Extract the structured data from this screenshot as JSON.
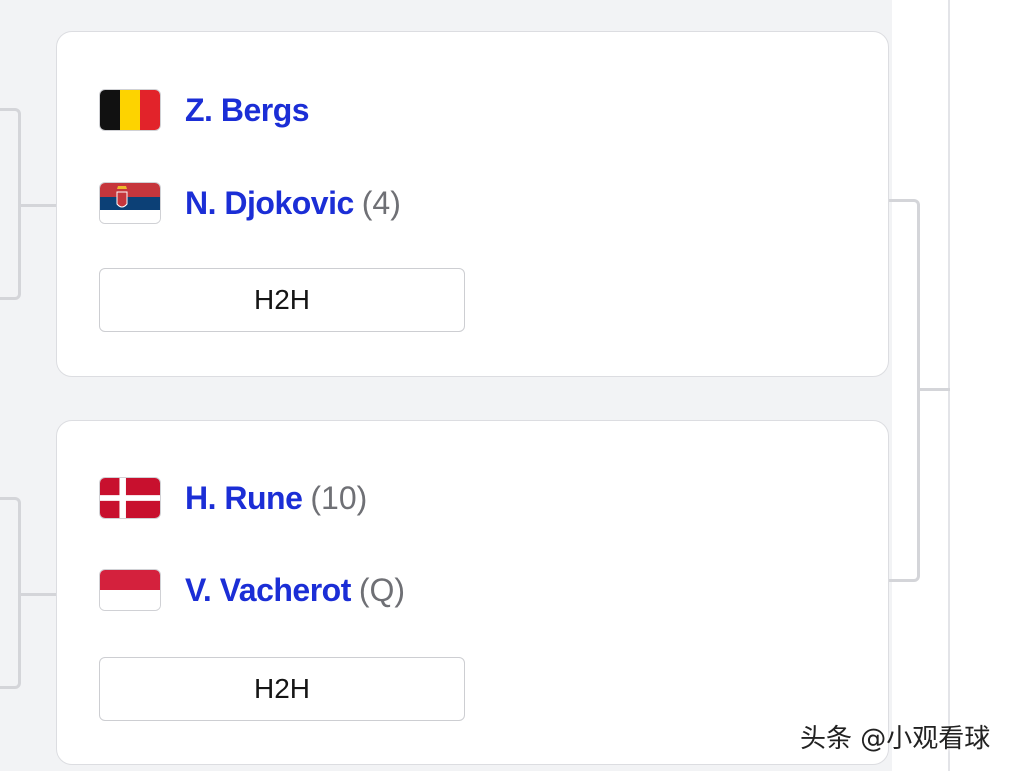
{
  "matches": [
    {
      "players": [
        {
          "name": "Z. Bergs",
          "seed": "",
          "flag": "belgium-flag-icon"
        },
        {
          "name": "N. Djokovic",
          "seed": "(4)",
          "flag": "serbia-flag-icon"
        }
      ],
      "h2h_label": "H2H"
    },
    {
      "players": [
        {
          "name": "H. Rune",
          "seed": "(10)",
          "flag": "denmark-flag-icon"
        },
        {
          "name": "V. Vacherot",
          "seed": "(Q)",
          "flag": "monaco-flag-icon"
        }
      ],
      "h2h_label": "H2H"
    }
  ],
  "watermark": "头条 @小观看球",
  "colors": {
    "player_link": "#1b2ed6",
    "seed": "#6f7075",
    "bracket_line": "#d4d5d9",
    "background": "#f2f3f5"
  }
}
